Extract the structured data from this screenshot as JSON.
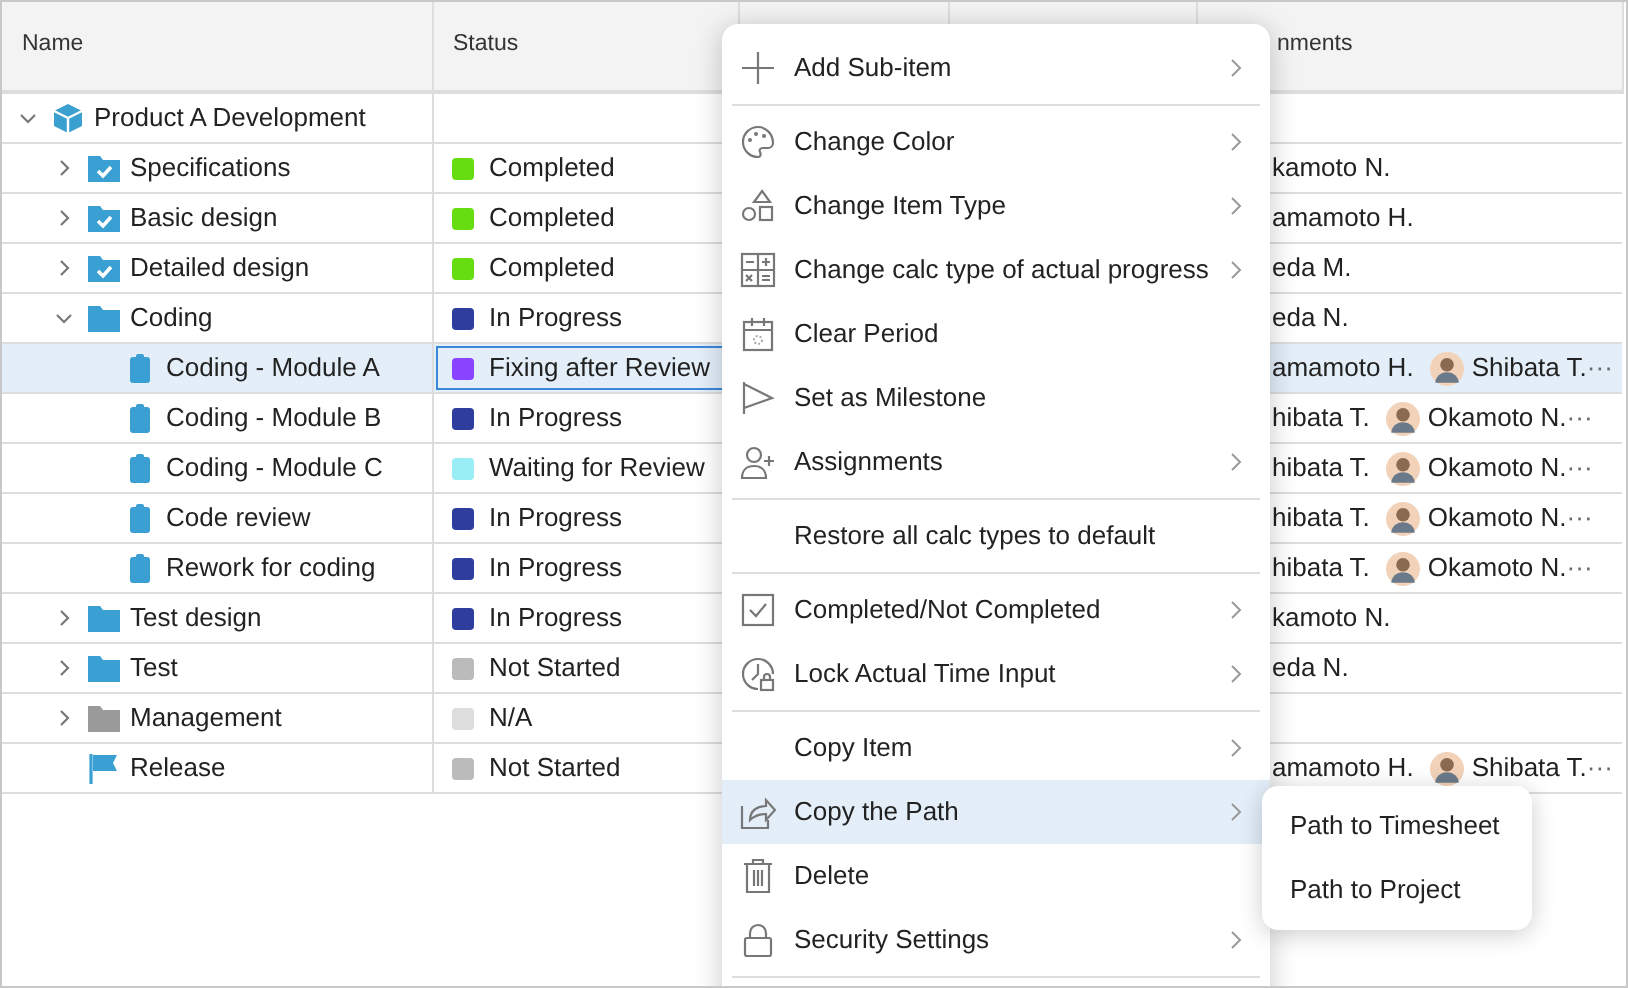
{
  "table": {
    "columns": [
      "Name",
      "Status",
      "nments"
    ],
    "rows": [
      {
        "name": "Product A Development",
        "kind": "project",
        "expanded": true,
        "selected": false,
        "children": [
          {
            "name": "Specifications",
            "kind": "folder",
            "expanded": false,
            "completed": true,
            "muted": false,
            "selected": false,
            "status": {
              "label": "Completed",
              "color": "#66dd11"
            },
            "assignees": [
              "kamoto N."
            ]
          },
          {
            "name": "Basic design",
            "kind": "folder",
            "expanded": false,
            "completed": true,
            "muted": false,
            "selected": false,
            "status": {
              "label": "Completed",
              "color": "#66dd11"
            },
            "assignees": [
              "amamoto H."
            ]
          },
          {
            "name": "Detailed design",
            "kind": "folder",
            "expanded": false,
            "completed": true,
            "muted": false,
            "selected": false,
            "status": {
              "label": "Completed",
              "color": "#66dd11"
            },
            "assignees": [
              "eda M."
            ]
          },
          {
            "name": "Coding",
            "kind": "folder",
            "expanded": true,
            "completed": false,
            "muted": false,
            "selected": false,
            "status": {
              "label": "In Progress",
              "color": "#2e3d9e"
            },
            "assignees": [
              "eda N."
            ],
            "children": [
              {
                "name": "Coding - Module A",
                "kind": "task",
                "selected": true,
                "status": {
                  "label": "Fixing after Review",
                  "color": "#8844ff"
                },
                "assignees": [
                  "amamoto H.",
                  "Shibata T."
                ],
                "more": "···"
              },
              {
                "name": "Coding - Module B",
                "kind": "task",
                "selected": false,
                "status": {
                  "label": "In Progress",
                  "color": "#2e3d9e"
                },
                "assignees": [
                  "hibata T.",
                  "Okamoto N."
                ],
                "more": "···"
              },
              {
                "name": "Coding - Module C",
                "kind": "task",
                "selected": false,
                "status": {
                  "label": "Waiting for Review",
                  "color": "#99eef5"
                },
                "assignees": [
                  "hibata T.",
                  "Okamoto N."
                ],
                "more": "···"
              },
              {
                "name": "Code review",
                "kind": "task",
                "selected": false,
                "status": {
                  "label": "In Progress",
                  "color": "#2e3d9e"
                },
                "assignees": [
                  "hibata T.",
                  "Okamoto N."
                ],
                "more": "···"
              },
              {
                "name": "Rework for coding",
                "kind": "task",
                "selected": false,
                "status": {
                  "label": "In Progress",
                  "color": "#2e3d9e"
                },
                "assignees": [
                  "hibata T.",
                  "Okamoto N."
                ],
                "more": "···"
              }
            ]
          },
          {
            "name": "Test design",
            "kind": "folder",
            "expanded": false,
            "completed": false,
            "muted": false,
            "selected": false,
            "status": {
              "label": "In Progress",
              "color": "#2e3d9e"
            },
            "assignees": [
              "kamoto N."
            ]
          },
          {
            "name": "Test",
            "kind": "folder",
            "expanded": false,
            "completed": false,
            "muted": false,
            "selected": false,
            "status": {
              "label": "Not Started",
              "color": "#bbbbbb"
            },
            "assignees": [
              "eda N."
            ]
          },
          {
            "name": "Management",
            "kind": "folder",
            "expanded": false,
            "completed": false,
            "muted": true,
            "selected": false,
            "status": {
              "label": "N/A",
              "color": "#dddddd"
            }
          },
          {
            "name": "Release",
            "kind": "milestone",
            "selected": false,
            "status": {
              "label": "Not Started",
              "color": "#bbbbbb"
            },
            "assignees": [
              "amamoto H.",
              "Shibata T."
            ],
            "more": "···"
          }
        ]
      }
    ]
  },
  "context_menu": {
    "groups": [
      [
        {
          "label": "Add Sub-item",
          "submenu": true,
          "selected": false
        }
      ],
      [
        {
          "label": "Change Color",
          "submenu": true,
          "selected": false
        },
        {
          "label": "Change Item Type",
          "submenu": true,
          "selected": false
        },
        {
          "label": "Change calc type of actual progress",
          "submenu": true,
          "selected": false
        },
        {
          "label": "Clear Period",
          "submenu": false,
          "selected": false
        },
        {
          "label": "Set as Milestone",
          "submenu": false,
          "selected": false
        },
        {
          "label": "Assignments",
          "submenu": true,
          "selected": false
        }
      ],
      [
        {
          "label": "Restore all calc types to default",
          "submenu": false,
          "selected": false
        }
      ],
      [
        {
          "label": "Completed/Not Completed",
          "submenu": true,
          "selected": false
        },
        {
          "label": "Lock Actual Time Input",
          "submenu": true,
          "selected": false
        }
      ],
      [
        {
          "label": "Copy Item",
          "submenu": true,
          "selected": false
        },
        {
          "label": "Copy the Path",
          "submenu": true,
          "selected": true
        },
        {
          "label": "Delete",
          "submenu": false,
          "selected": false
        },
        {
          "label": "Security Settings",
          "submenu": true,
          "selected": false
        }
      ]
    ],
    "submenu": {
      "items": [
        "Path to Timesheet",
        "Path to Project"
      ]
    }
  }
}
